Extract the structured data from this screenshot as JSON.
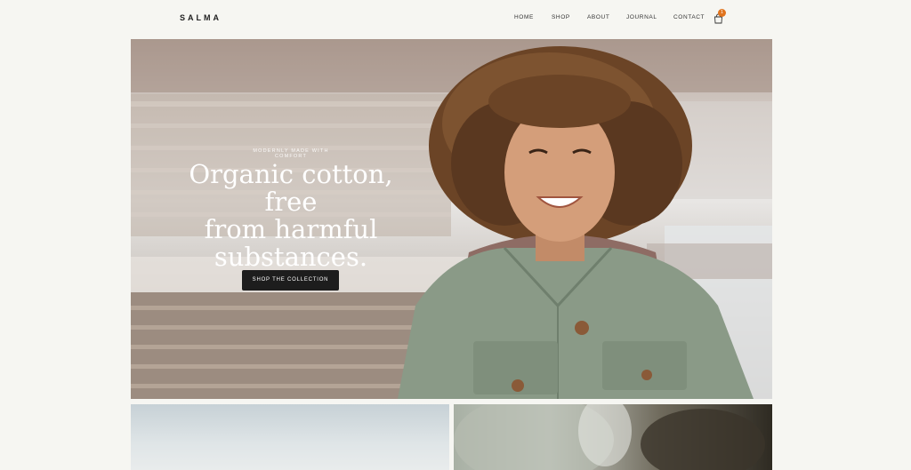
{
  "brand": {
    "logo": "SALMA"
  },
  "nav": {
    "home": "HOME",
    "shop": "SHOP",
    "about": "ABOUT",
    "journal": "JOURNAL",
    "contact": "CONTACT"
  },
  "cart": {
    "count": "1",
    "icon": "shopping-bag-icon"
  },
  "hero": {
    "kicker": "MODERNLY MADE WITH COMFORT",
    "headline_line1": "Organic cotton, free",
    "headline_line2": "from harmful",
    "headline_line3": "substances.",
    "cta_label": "SHOP THE COLLECTION"
  },
  "colors": {
    "background": "#f6f6f2",
    "accent": "#e1741e",
    "button": "#1d1d1d",
    "jacket": "#8a9a87"
  }
}
